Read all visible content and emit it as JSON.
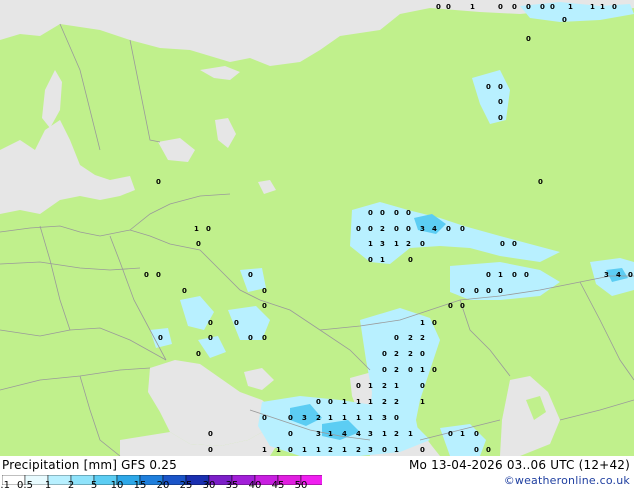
{
  "footer": {
    "title": "Precipitation [mm]  GFS 0.25",
    "datetime": "Mo 13-04-2026 03..06 UTC (12+42)",
    "credit": "©weatheronline.co.uk"
  },
  "legend": {
    "labels": [
      "0.1",
      "0.5",
      "1",
      "2",
      "5",
      "10",
      "15",
      "20",
      "25",
      "30",
      "35",
      "40",
      "45",
      "50"
    ],
    "colors": [
      "#ffffff",
      "#e8fbff",
      "#b8f0ff",
      "#8fe3fb",
      "#5ccdf3",
      "#2ea8e8",
      "#1f7fdc",
      "#1b55c8",
      "#1a2fb0",
      "#7c1fc8",
      "#a21fd8",
      "#c81fe0",
      "#e01fe0",
      "#f01ff0"
    ]
  },
  "map": {
    "land_color": "#c0f08c",
    "sea_color": "#e6e6e6",
    "border_color": "#9a9a9a",
    "precip_values": [
      {
        "group": "north-coast-top",
        "values": [
          "0",
          "0",
          "1",
          "0",
          "0",
          "0",
          "0",
          "0",
          "0",
          "1",
          "1",
          "1",
          "0"
        ]
      },
      {
        "group": "ural-north",
        "values": [
          "0",
          "0",
          "0",
          "0"
        ]
      },
      {
        "group": "scandinavia",
        "values": [
          "0",
          "1",
          "0",
          "0"
        ]
      },
      {
        "group": "baltic",
        "values": [
          "0",
          "0",
          "0",
          "0",
          "0"
        ]
      },
      {
        "group": "central-russia",
        "values": [
          "0",
          "0",
          "0",
          "0",
          "0",
          "2",
          "0",
          "0",
          "3",
          "4",
          "0",
          "0",
          "1",
          "3",
          "1",
          "2",
          "0",
          "0",
          "1",
          "0",
          "0",
          "0"
        ]
      },
      {
        "group": "ukraine",
        "values": [
          "0",
          "0",
          "0",
          "0",
          "0",
          "0",
          "0",
          "0",
          "0"
        ]
      },
      {
        "group": "kazakhstan",
        "values": [
          "0",
          "1",
          "0",
          "0",
          "3",
          "4",
          "0",
          "0",
          "0",
          "0",
          "0"
        ]
      },
      {
        "group": "caspian",
        "values": [
          "1",
          "0",
          "0",
          "2",
          "2",
          "2",
          "2",
          "0",
          "2",
          "0",
          "1",
          "0",
          "0",
          "1",
          "2",
          "1",
          "0",
          "0",
          "1",
          "1",
          "2",
          "0",
          "0",
          "1",
          "1",
          "2",
          "2",
          "1",
          "1",
          "1",
          "3",
          "0"
        ]
      },
      {
        "group": "caucasus",
        "values": [
          "0",
          "0",
          "3",
          "2",
          "1",
          "1",
          "1",
          "1",
          "3",
          "0",
          "3",
          "1",
          "4",
          "4",
          "3",
          "1",
          "2",
          "1",
          "0",
          "1",
          "1",
          "0",
          "1",
          "1",
          "2",
          "1",
          "2",
          "3",
          "0",
          "1",
          "0",
          "0",
          "0"
        ]
      }
    ]
  }
}
